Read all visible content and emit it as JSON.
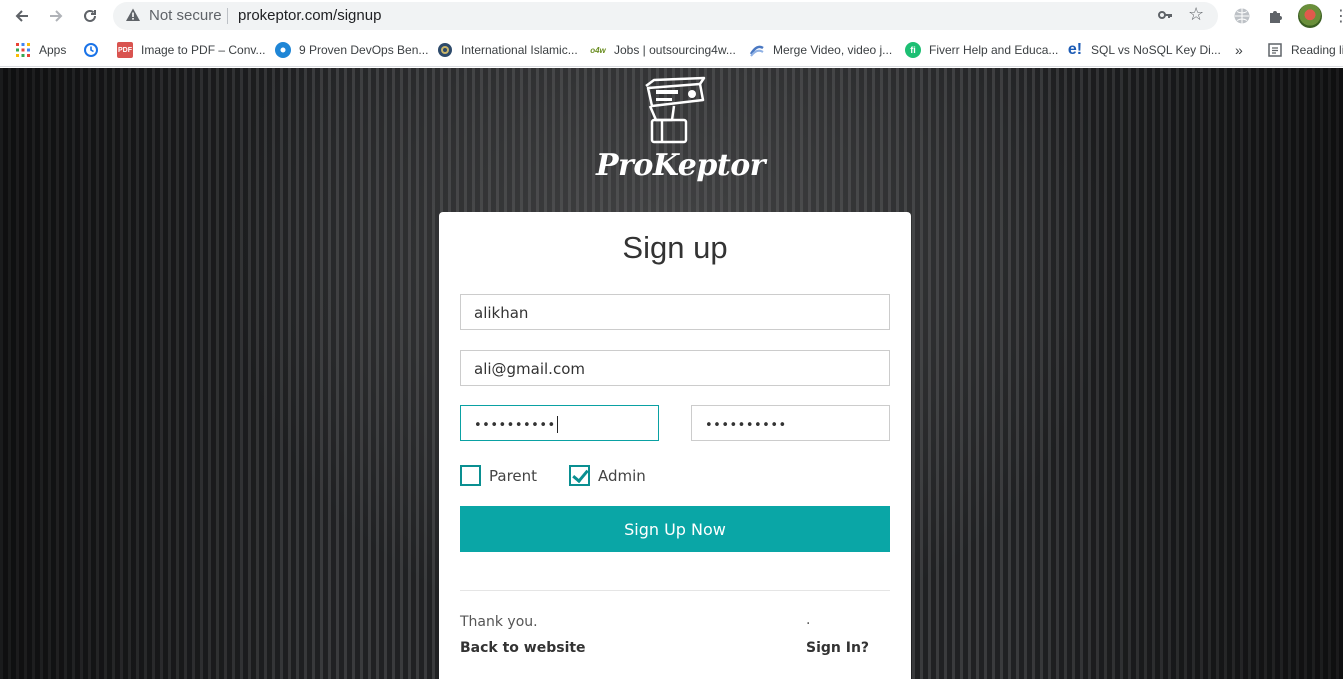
{
  "browser": {
    "security_label": "Not secure",
    "url": "prokeptor.com/signup",
    "bookmarks": [
      {
        "label": "Apps",
        "icon": "apps-grid-icon"
      },
      {
        "label": "",
        "icon": "history-icon"
      },
      {
        "label": "Image to PDF – Conv...",
        "icon": "pdf-icon"
      },
      {
        "label": "9 Proven DevOps Ben...",
        "icon": "devops-icon"
      },
      {
        "label": "International Islamic...",
        "icon": "university-icon"
      },
      {
        "label": "Jobs | outsourcing4w...",
        "icon": "o4w-icon"
      },
      {
        "label": "Merge Video, video j...",
        "icon": "video-icon"
      },
      {
        "label": "Fiverr Help and Educa...",
        "icon": "fiverr-icon"
      },
      {
        "label": "SQL vs NoSQL Key Di...",
        "icon": "edureka-icon"
      },
      {
        "label": "»",
        "icon": "more-chevron-icon"
      },
      {
        "label": "Reading li",
        "icon": "reading-list-icon"
      }
    ]
  },
  "brand": {
    "name": "ProKeptor"
  },
  "signup": {
    "title": "Sign up",
    "username_value": "alikhan",
    "email_value": "ali@gmail.com",
    "password_value": "••••••••••",
    "confirm_password_value": "••••••••••",
    "roles": [
      {
        "label": "Parent",
        "checked": false
      },
      {
        "label": "Admin",
        "checked": true
      }
    ],
    "submit_label": "Sign Up Now",
    "footer_text": "Thank you.",
    "back_link": "Back to website",
    "dot_text": ".",
    "signin_link": "Sign In?"
  },
  "colors": {
    "accent": "#0aa6a6",
    "card_bg": "#ffffff",
    "page_bg": "#2a2b2d"
  }
}
